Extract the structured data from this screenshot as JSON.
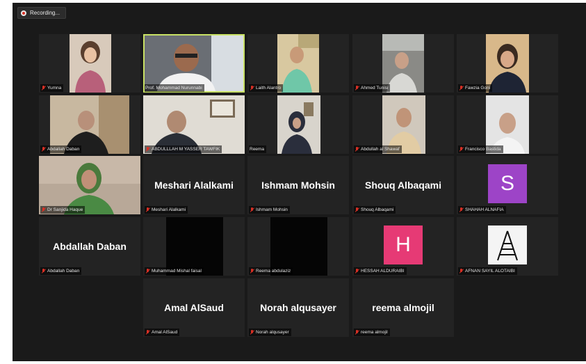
{
  "recording": {
    "label": "Recording..."
  },
  "participants": [
    {
      "name": "Yumna"
    },
    {
      "name": "Prof. Mohammad Nurunnabi"
    },
    {
      "name": "Laith Alantro"
    },
    {
      "name": "Ahmed Tunisi"
    },
    {
      "name": "Fawzia Goni"
    },
    {
      "name": "Abdallah Daban"
    },
    {
      "name": "ABDULLLAH M YASSER TAWFIK"
    },
    {
      "name": "Reema"
    },
    {
      "name": "Abdullah al Shawaf"
    },
    {
      "name": "Francisco Bastida"
    },
    {
      "name": "Dr Sanjida Haque"
    },
    {
      "name": "Meshari Alalkami"
    },
    {
      "name": "Ishmam Mohsin"
    },
    {
      "name": "Shouq Albaqami"
    },
    {
      "name": "SHAHAH ALNAFIA",
      "avatar": "S"
    },
    {
      "name": "Abdallah Daban"
    },
    {
      "name": "Muhammad Mishal faisal"
    },
    {
      "name": "Reema abdulaziz"
    },
    {
      "name": "HESSAH ALDURAIBI",
      "avatar": "H"
    },
    {
      "name": "AFNAN SAYIL ALOTAIBI"
    },
    {
      "name": "Amal AlSaud"
    },
    {
      "name": "Norah alqusayer"
    },
    {
      "name": "reema almojil"
    }
  ],
  "icons": {
    "muted": "mic-off-icon",
    "recording": "record-icon"
  }
}
